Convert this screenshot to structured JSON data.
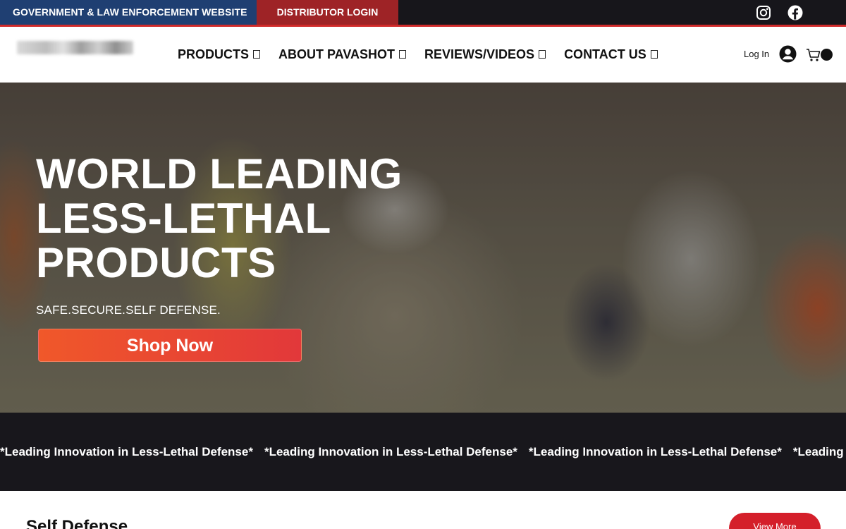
{
  "topbar": {
    "gov_link": "GOVERNMENT & LAW ENFORCEMENT WEBSITE",
    "distributor_link": "DISTRIBUTOR LOGIN",
    "social_icons": [
      "instagram-icon",
      "facebook-icon"
    ]
  },
  "header": {
    "nav": [
      {
        "label": "PRODUCTS"
      },
      {
        "label": "ABOUT PAVASHOT"
      },
      {
        "label": "REVIEWS/VIDEOS"
      },
      {
        "label": "CONTACT US"
      }
    ],
    "login_label": "Log In",
    "cart_count": ""
  },
  "hero": {
    "title": "WORLD LEADING LESS-LETHAL PRODUCTS",
    "tagline": "SAFE.SECURE.SELF DEFENSE.",
    "cta_label": "Shop Now"
  },
  "marquee": {
    "items": [
      "*Leading Innovation in Less-Lethal Defense*",
      "*Leading Innovation in Less-Lethal Defense*",
      "*Leading Innovation in Less-Lethal Defense*",
      "*Leading Innovation in Less-Lethal Defense*"
    ]
  },
  "section": {
    "title": "Self Defense",
    "view_more_label": "View More"
  },
  "colors": {
    "topbar_bg": "#17161b",
    "gov_bg": "#1f3f72",
    "distributor_bg": "#9e2326",
    "accent_red": "#d41f2a",
    "cta_gradient_start": "#f0582a",
    "cta_gradient_end": "#e2383a",
    "marquee_bg": "#18171c"
  }
}
